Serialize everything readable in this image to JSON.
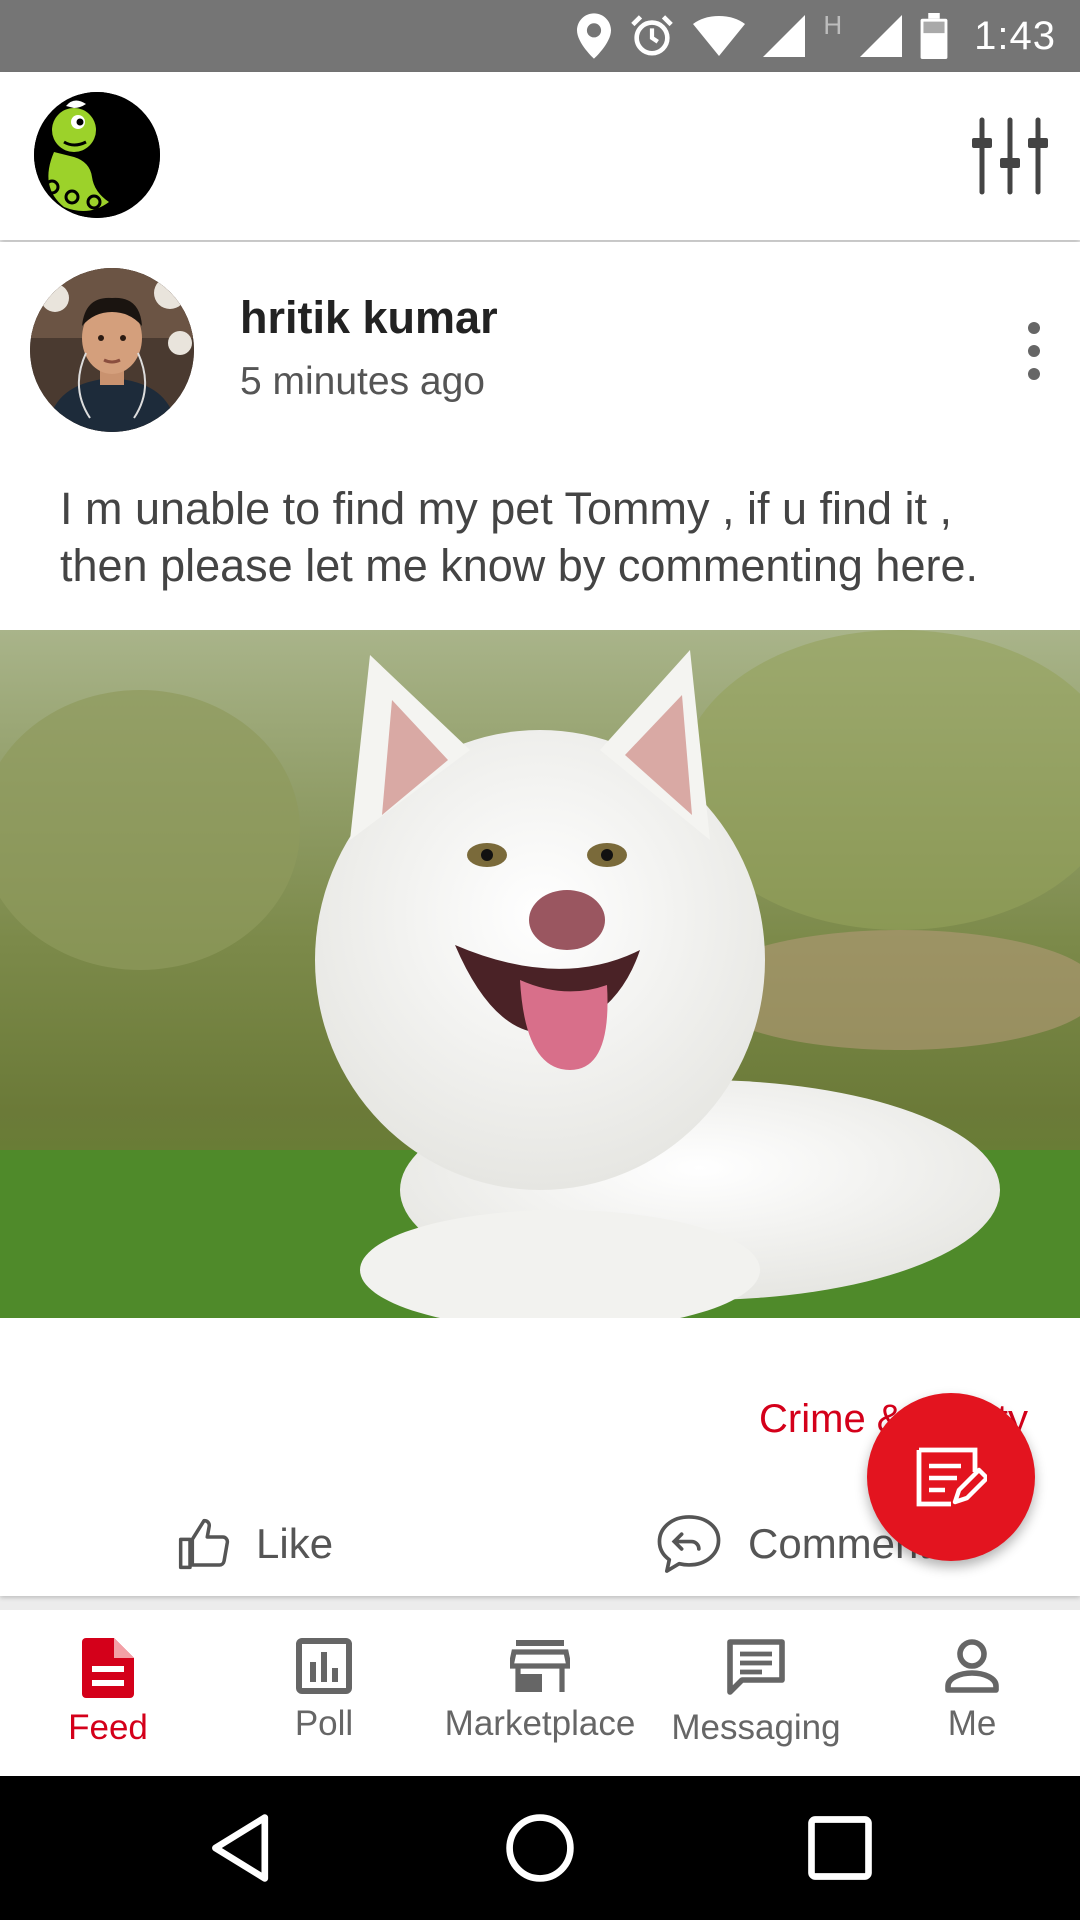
{
  "status_bar": {
    "time": "1:43",
    "network_type": "H",
    "icons": [
      "location-icon",
      "alarm-icon",
      "wifi-icon",
      "signal-icon",
      "signal-icon",
      "battery-icon"
    ]
  },
  "app_bar": {
    "logo_icon": "app-logo-icon",
    "filter_icon": "tune-sliders-icon"
  },
  "post": {
    "author": "hritik kumar",
    "time_ago": "5 minutes ago",
    "text": "I m unable to find my pet Tommy , if u find it , then please let me know by commenting here.",
    "category": "Crime & Safety",
    "like_label": "Like",
    "comment_label": "Comment"
  },
  "bottom_nav": {
    "items": [
      {
        "label": "Feed",
        "icon": "document-icon",
        "active": true
      },
      {
        "label": "Poll",
        "icon": "bar-chart-icon",
        "active": false
      },
      {
        "label": "Marketplace",
        "icon": "store-icon",
        "active": false
      },
      {
        "label": "Messaging",
        "icon": "message-icon",
        "active": false
      },
      {
        "label": "Me",
        "icon": "person-icon",
        "active": false
      }
    ]
  },
  "colors": {
    "accent": "#d4001a",
    "fab": "#e3141f",
    "status_bar": "#757575"
  }
}
